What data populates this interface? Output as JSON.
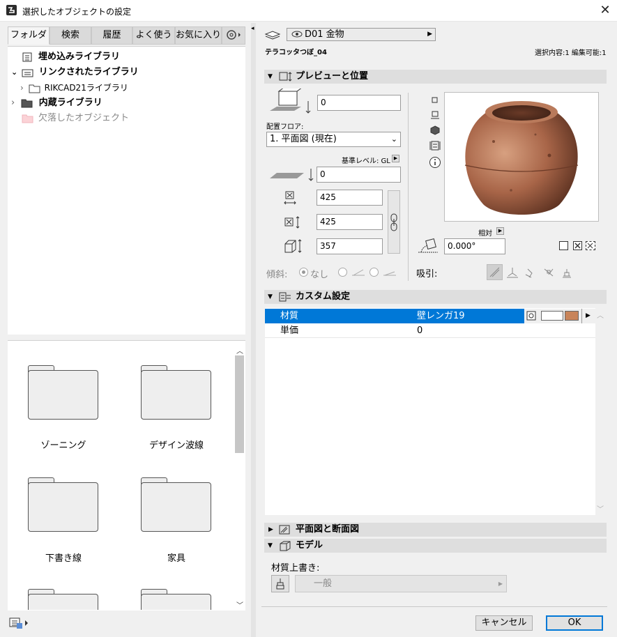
{
  "window": {
    "title": "選択したオブジェクトの設定",
    "close_glyph": "✕"
  },
  "tabs": [
    {
      "label": "フォルダ",
      "active": true
    },
    {
      "label": "検索"
    },
    {
      "label": "履歴"
    },
    {
      "label": "よく使う"
    },
    {
      "label": "お気に入り"
    }
  ],
  "tree": [
    {
      "label": "埋め込みライブラリ",
      "icon": "library-icon"
    },
    {
      "label": "リンクされたライブラリ",
      "icon": "library-icon"
    },
    {
      "label": "RIKCAD21ライブラリ",
      "icon": "folder-icon"
    },
    {
      "label": "内蔵ライブラリ",
      "icon": "folder-dark-icon"
    },
    {
      "label": "欠落したオブジェクト",
      "icon": "folder-pink-icon"
    }
  ],
  "grid_items": [
    "ゾーニング",
    "デザイン波線",
    "下書き線",
    "家具"
  ],
  "object": {
    "layer": "D01 金物",
    "name": "テラコッタつぼ_04",
    "selection_status": "選択内容:1 編集可能:1"
  },
  "preview_section": {
    "title": "プレビューと位置",
    "elevation": "0",
    "floor_label": "配置フロア:",
    "floor_value": "1. 平面図 (現在)",
    "reference_level": "基準レベル: GL",
    "offset": "0",
    "width": "425",
    "depth": "425",
    "height": "357",
    "relative_label": "相対",
    "angle": "0.000°",
    "tilt_label": "傾斜:",
    "tilt_none": "なし",
    "snap_label": "吸引:"
  },
  "custom_section": {
    "title": "カスタム設定",
    "rows": [
      {
        "name": "材質",
        "value": "壁レンガ19",
        "swatch": "#c8845a"
      },
      {
        "name": "単価",
        "value": "0"
      }
    ]
  },
  "plan_section": {
    "title": "平面図と断面図"
  },
  "model_section": {
    "title": "モデル",
    "override_label": "材質上書き:",
    "override_value": "一般"
  },
  "buttons": {
    "cancel": "キャンセル",
    "ok": "OK"
  }
}
